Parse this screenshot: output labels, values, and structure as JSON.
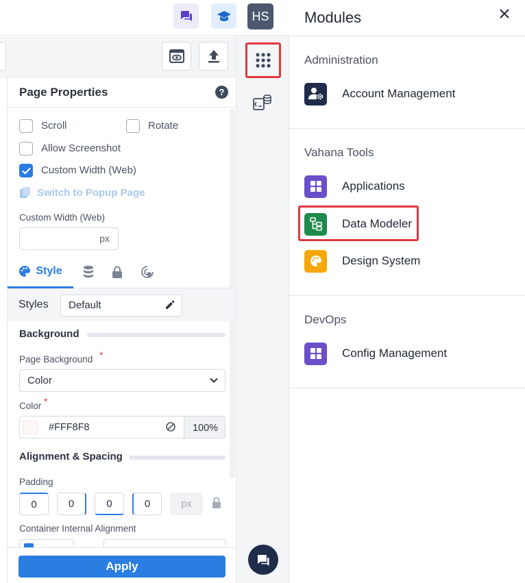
{
  "header": {
    "avatar_initials": "HS"
  },
  "page_properties": {
    "title": "Page Properties",
    "help": "?",
    "checkboxes": [
      {
        "label": "Scroll",
        "checked": false
      },
      {
        "label": "Rotate",
        "checked": false
      },
      {
        "label": "Allow Screenshot",
        "checked": false
      },
      {
        "label": "Custom Width (Web)",
        "checked": true
      }
    ],
    "switch_link": "Switch to Popup Page",
    "custom_width_label": "Custom Width (Web)",
    "custom_width_value": "",
    "custom_width_unit": "px"
  },
  "tabs": {
    "style_label": "Style"
  },
  "styles": {
    "label": "Styles",
    "value": "Default"
  },
  "background": {
    "section_title": "Background",
    "page_background_label": "Page Background",
    "page_background_value": "Color",
    "color_label": "Color",
    "color_hex": "#FFF8F8",
    "color_opacity": "100%",
    "required_mark": "*"
  },
  "alignment": {
    "section_title": "Alignment & Spacing",
    "padding_label": "Padding",
    "padding": {
      "top": "0",
      "right": "0",
      "bottom": "0",
      "left": "0"
    },
    "padding_unit": "px",
    "container_alignment_label": "Container Internal Alignment"
  },
  "apply_label": "Apply",
  "modules": {
    "title": "Modules",
    "groups": [
      {
        "title": "Administration",
        "items": [
          {
            "label": "Account Management",
            "color": "#1f2d4a"
          }
        ]
      },
      {
        "title": "Vahana Tools",
        "items": [
          {
            "label": "Applications",
            "color": "#6b4fc9"
          },
          {
            "label": "Data Modeler",
            "color": "#1e8a4c"
          },
          {
            "label": "Design System",
            "color": "#f6a70b"
          }
        ]
      },
      {
        "title": "DevOps",
        "items": [
          {
            "label": "Config Management",
            "color": "#6b4fc9"
          }
        ]
      }
    ]
  },
  "colors": {
    "accent": "#2a7de1",
    "highlight": "#e0393e"
  }
}
